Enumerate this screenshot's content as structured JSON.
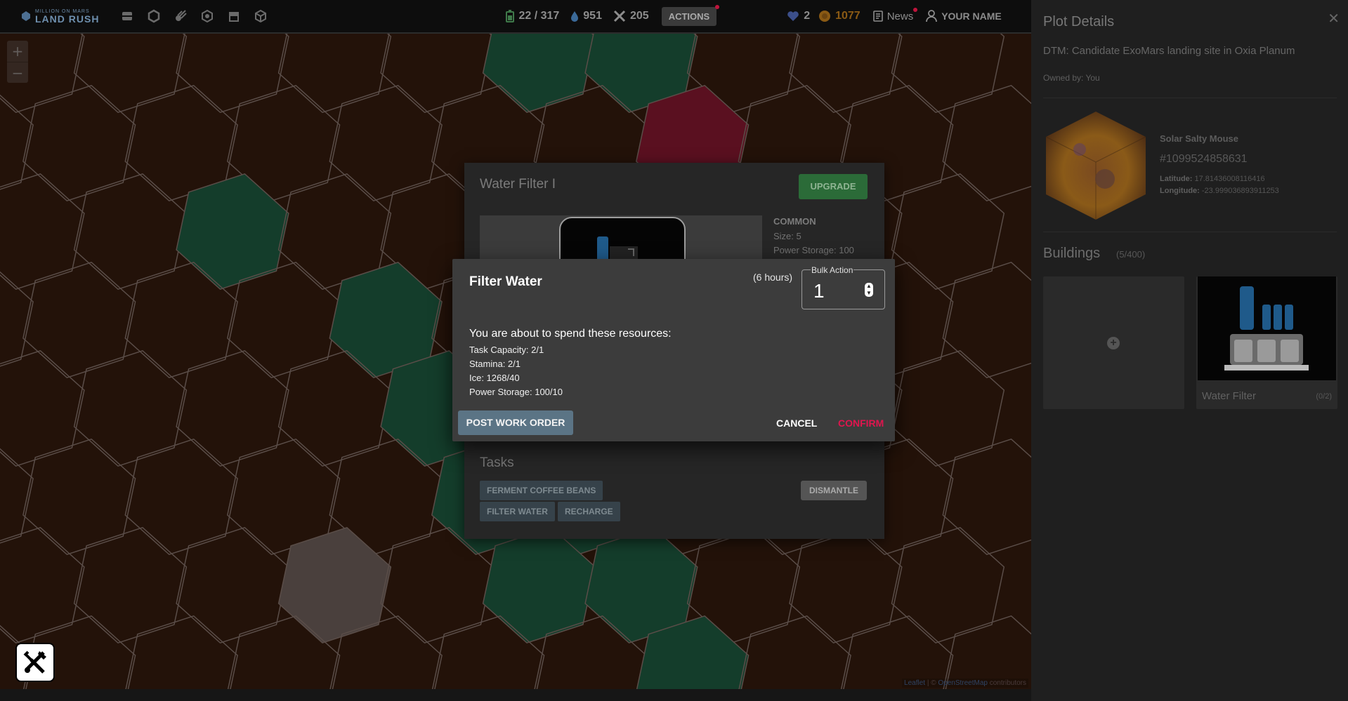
{
  "brand": {
    "line1": "MILLION ON MARS",
    "line2": "LAND RUSH"
  },
  "resources": {
    "energy": "22 / 317",
    "water": "951",
    "tools": "205"
  },
  "actions_label": "ACTIONS",
  "user": {
    "gems": "2",
    "coins": "1077",
    "news_label": "News",
    "name": "YOUR NAME"
  },
  "map": {
    "attribution_leaflet": "Leaflet",
    "attribution_sep": " | © ",
    "attribution_osm": "OpenStreetMap",
    "attribution_tail": " contributors"
  },
  "plot": {
    "title": "Plot Details",
    "subtitle": "DTM: Candidate ExoMars landing site in Oxia Planum",
    "owner": "Owned by: You",
    "name": "Solar Salty Mouse",
    "id": "#1099524858631",
    "latitude_label": "Latitude:",
    "latitude": "17.81436008116416",
    "longitude_label": "Longitude:",
    "longitude": "-23.999036893911253",
    "buildings_label": "Buildings",
    "buildings_count": "(5/400)",
    "slot_name": "Water Filter",
    "slot_count": "(0/2)"
  },
  "building": {
    "title": "Water Filter I",
    "upgrade_label": "UPGRADE",
    "rarity": "COMMON",
    "size": "Size: 5",
    "power_storage": "Power Storage: 100",
    "tasks_label": "Tasks",
    "tasks": [
      "FERMENT COFFEE BEANS",
      "FILTER WATER",
      "RECHARGE"
    ],
    "dismantle_label": "DISMANTLE"
  },
  "dialog": {
    "title": "Filter Water",
    "duration": "(6 hours)",
    "bulk_label": "Bulk Action",
    "bulk_value": "1",
    "spend_heading": "You are about to spend these resources:",
    "costs": [
      "Task Capacity: 2/1",
      "Stamina: 2/1",
      "Ice: 1268/40",
      "Power Storage: 100/10"
    ],
    "post_label": "POST WORK ORDER",
    "cancel_label": "CANCEL",
    "confirm_label": "CONFIRM"
  },
  "colors": {
    "map_bg": "#231209",
    "hex_green": "#143d2b",
    "hex_red": "#5a1020",
    "hex_grey": "#4a403d",
    "confirm": "#e0154e",
    "upgrade": "#2b6b38"
  }
}
